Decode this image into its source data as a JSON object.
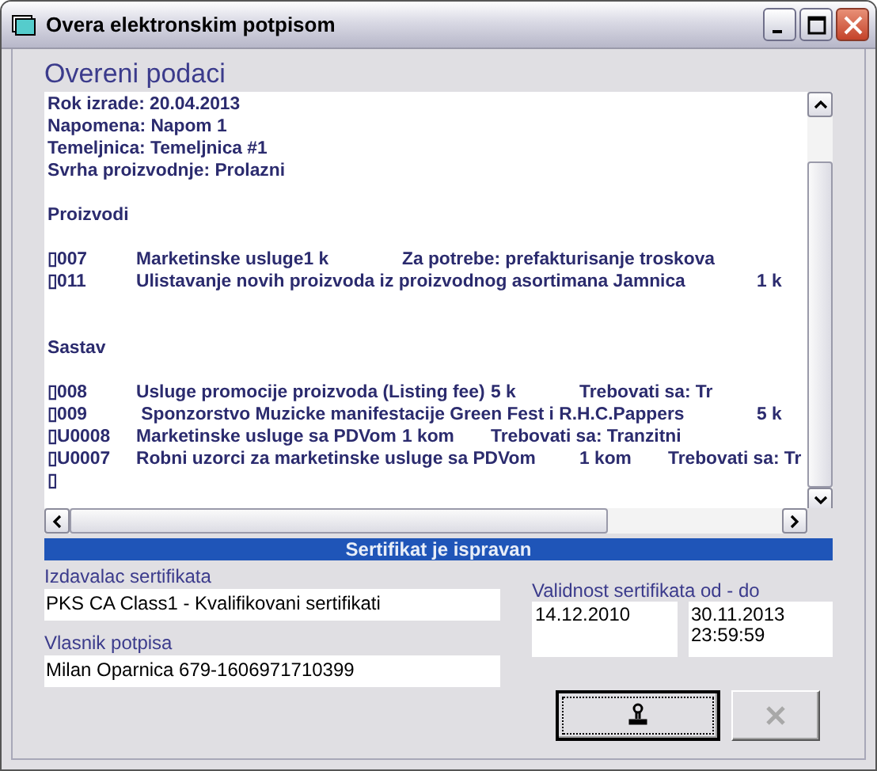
{
  "window": {
    "title": "Overa elektronskim potpisom"
  },
  "heading": "Overeni podaci",
  "document": {
    "header_lines": [
      "Rok izrade: 20.04.2013",
      "Napomena: Napom 1",
      "Temeljnica: Temeljnica #1",
      "Svrha proizvodnje: Prolazni"
    ],
    "sections": [
      {
        "title": "Proizvodi",
        "rows": [
          "▯007\tMarketinske usluge1 k\tZa potrebe: prefakturisanje troskova",
          "▯011\tUlistavanje novih proizvoda iz proizvodnog asortimana Jamnica\t1 k"
        ]
      },
      {
        "title": "Sastav",
        "rows": [
          "▯008\tUsluge promocije proizvoda (Listing fee)\t5 k\tTrebovati sa: Tr",
          "▯009\t Sponzorstvo Muzicke manifestacije Green Fest i R.H.C.Pappers\t5 k",
          "▯U0008\tMarketinske usluge sa PDVom\t1 kom\tTrebovati sa: Tranzitni",
          "▯U0007\tRobni uzorci za marketinske usluge sa PDVom\t1 kom\tTrebovati sa: Tr",
          "▯"
        ]
      }
    ]
  },
  "status": "Sertifikat je ispravan",
  "issuer": {
    "label": "Izdavalac sertifikata",
    "value": "PKS CA Class1 - Kvalifikovani sertifikati"
  },
  "owner": {
    "label": "Vlasnik potpisa",
    "value": "Milan Oparnica 679-1606971710399"
  },
  "validity": {
    "label": "Validnost sertifikata od - do",
    "from": "14.12.2010",
    "to": "30.11.2013\n23:59:59"
  },
  "buttons": [
    {
      "kind": "sign",
      "disabled": false,
      "focused": true
    },
    {
      "kind": "cancel",
      "disabled": true,
      "focused": false
    }
  ]
}
